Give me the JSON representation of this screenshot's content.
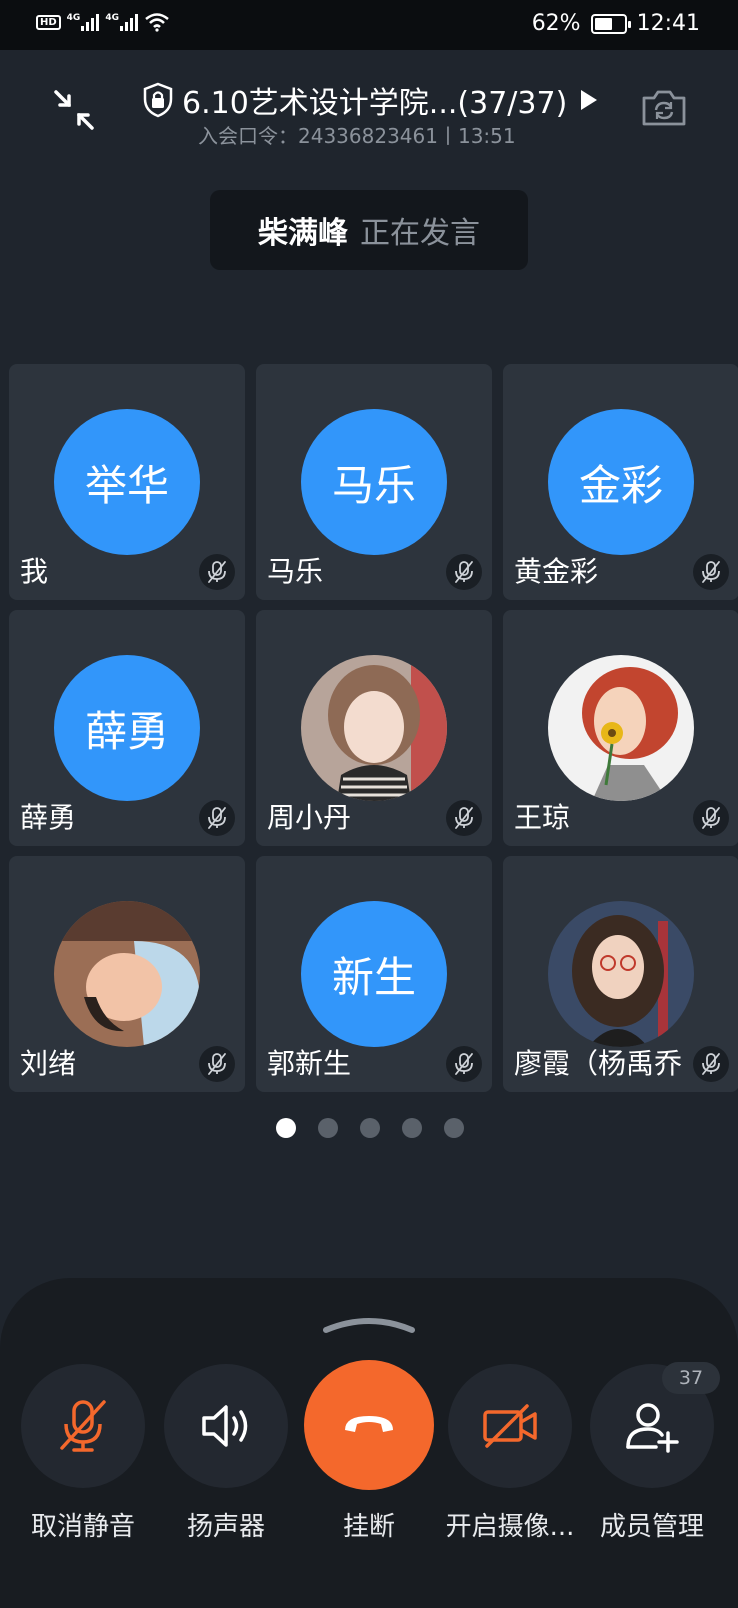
{
  "status_bar": {
    "left_icons": [
      "hd-icon",
      "4g-signal-icon",
      "4g-signal-icon",
      "wifi-icon"
    ],
    "net1": "4G",
    "net2": "4G",
    "battery": "62%",
    "battery_level": 0.62,
    "time": "12:41"
  },
  "meeting": {
    "title": "6.10艺术设计学院...(37/37)",
    "subtitle": "入会口令：24336823461丨13:51",
    "speaker_name": "柴满峰",
    "speaker_state": "正在发言"
  },
  "participants": [
    {
      "avatar_text": "举华",
      "name": "我",
      "avatar": "blue-initials"
    },
    {
      "avatar_text": "马乐",
      "name": "马乐",
      "avatar": "blue-initials"
    },
    {
      "avatar_text": "金彩",
      "name": "黄金彩",
      "avatar": "blue-initials"
    },
    {
      "avatar_text": "薛勇",
      "name": "薛勇",
      "avatar": "blue-initials"
    },
    {
      "avatar_text": "",
      "name": "周小丹",
      "avatar": "photo-girl"
    },
    {
      "avatar_text": "",
      "name": "王琼",
      "avatar": "cartoon-woman-flower"
    },
    {
      "avatar_text": "",
      "name": "刘绪",
      "avatar": "photo-baby"
    },
    {
      "avatar_text": "新生",
      "name": "郭新生",
      "avatar": "blue-initials"
    },
    {
      "avatar_text": "",
      "name": "廖霞（杨禹乔",
      "avatar": "photo-woman-glasses"
    }
  ],
  "pagination": {
    "pages": 5,
    "current": 1
  },
  "controls": {
    "unmute_label": "取消静音",
    "speaker_label": "扬声器",
    "hangup_label": "挂断",
    "camera_label": "开启摄像...",
    "members_label": "成员管理",
    "member_count": "37"
  },
  "colors": {
    "accent_blue": "#3296fa",
    "hangup_orange": "#f4682c",
    "muted_icon_orange": "#f4682c"
  }
}
